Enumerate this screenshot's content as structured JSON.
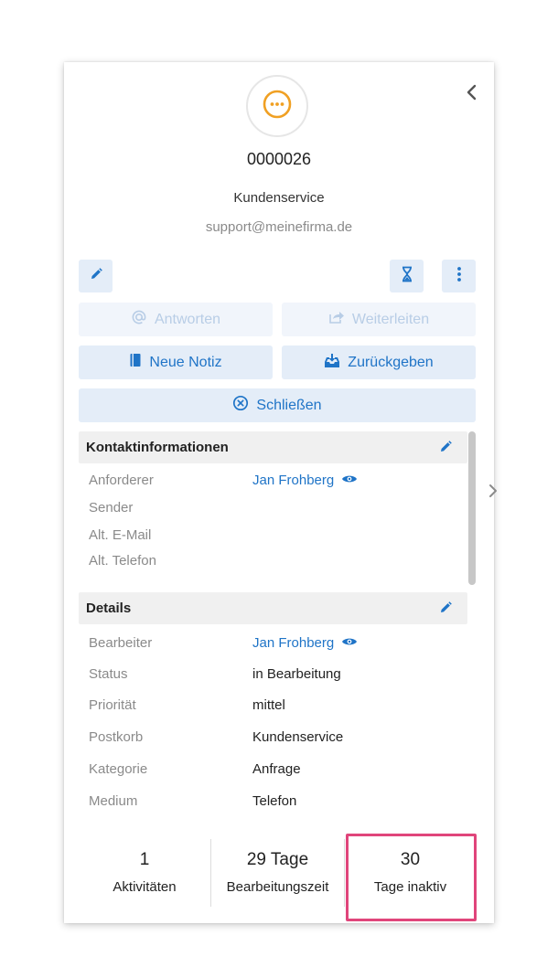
{
  "ticket": {
    "id": "0000026",
    "team": "Kundenservice",
    "email": "support@meinefirma.de"
  },
  "actions": {
    "reply": "Antworten",
    "forward": "Weiterleiten",
    "new_note": "Neue Notiz",
    "return": "Zurückgeben",
    "close": "Schließen"
  },
  "contact": {
    "title": "Kontaktinformationen",
    "rows": [
      {
        "label": "Anforderer",
        "value": "Jan Frohberg"
      },
      {
        "label": "Sender",
        "value": ""
      },
      {
        "label": "Alt. E-Mail",
        "value": ""
      },
      {
        "label": "Alt. Telefon",
        "value": ""
      }
    ]
  },
  "details": {
    "title": "Details",
    "rows": [
      {
        "label": "Bearbeiter",
        "value": "Jan Frohberg"
      },
      {
        "label": "Status",
        "value": "in Bearbeitung"
      },
      {
        "label": "Priorität",
        "value": "mittel"
      },
      {
        "label": "Postkorb",
        "value": "Kundenservice"
      },
      {
        "label": "Kategorie",
        "value": "Anfrage"
      },
      {
        "label": "Medium",
        "value": "Telefon"
      }
    ]
  },
  "stats": [
    {
      "value": "1",
      "label": "Aktivitäten"
    },
    {
      "value": "29 Tage",
      "label": "Bearbeitungszeit"
    },
    {
      "value": "30",
      "label": "Tage inaktiv"
    }
  ],
  "colors": {
    "accent": "#1f74c7",
    "avatar_icon": "#f0a023",
    "highlight": "#e0457b"
  }
}
